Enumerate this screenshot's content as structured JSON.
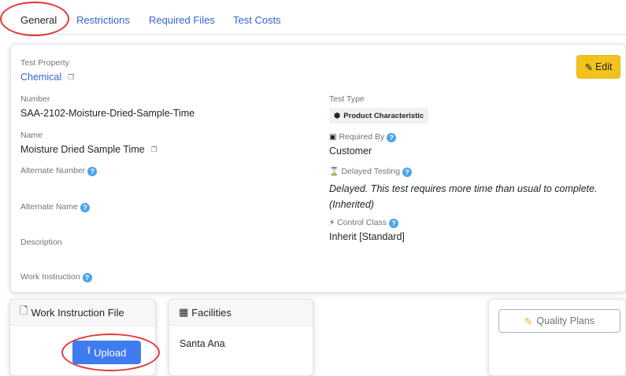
{
  "tabs": {
    "general": "General",
    "restrictions": "Restrictions",
    "required_files": "Required Files",
    "test_costs": "Test Costs"
  },
  "main": {
    "edit_label": "Edit",
    "test_property_label": "Test Property",
    "test_property_value": "Chemical",
    "number_label": "Number",
    "number_value": "SAA-2102-Moisture-Dried-Sample-Time",
    "name_label": "Name",
    "name_value": "Moisture Dried Sample Time",
    "alternate_number_label": "Alternate Number",
    "alternate_name_label": "Alternate Name",
    "description_label": "Description",
    "work_instruction_label": "Work Instruction",
    "test_type_label": "Test Type",
    "test_type_value": "Product Characteristic",
    "required_by_label": "Required By",
    "required_by_value": "Customer",
    "delayed_testing_label": "Delayed Testing",
    "delayed_testing_value_line1": "Delayed. This test requires more time than usual to complete.",
    "delayed_testing_value_line2": "(Inherited)",
    "control_class_label": "Control Class",
    "control_class_value": "Inherit [Standard]"
  },
  "work_instruction_file": {
    "title": "Work Instruction File",
    "upload_label": "Upload"
  },
  "facilities": {
    "title": "Facilities",
    "items": [
      "Santa Ana"
    ]
  },
  "quality_plans": {
    "button_label": "Quality Plans"
  },
  "colors": {
    "link": "#3563d9",
    "edit_button": "#f3c31d",
    "upload_button": "#3f7cf0",
    "help_icon": "#4da3e8",
    "annotation_circle": "#e03a3a"
  },
  "icons": [
    "copy-icon",
    "pencil-icon",
    "cube-icon",
    "document-icon",
    "help-icon",
    "hourglass-icon",
    "magic-wand-icon",
    "file-icon",
    "building-icon",
    "upload-icon",
    "edit-icon"
  ]
}
